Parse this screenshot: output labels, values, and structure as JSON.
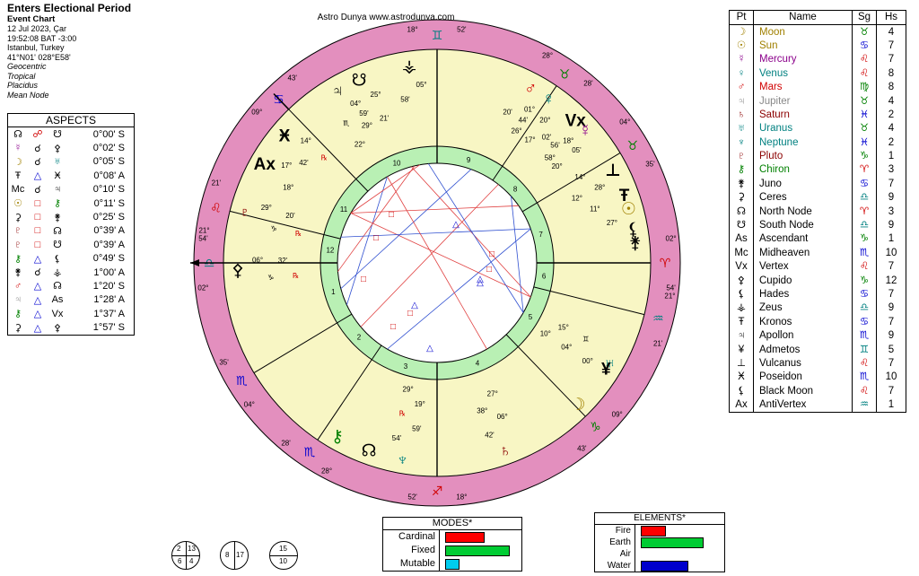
{
  "header": {
    "title": "Enters Electional Period",
    "subtitle": "Event Chart",
    "date": "12 Jul 2023, Çar",
    "time": "19:52:08  BAT -3:00",
    "place": "Istanbul, Turkey",
    "coords": "41°N01' 028°E58'",
    "lines": [
      "Geocentric",
      "Tropical",
      "Placidus",
      "Mean Node"
    ]
  },
  "credit": "Astro Dunya www.astrodunya.com",
  "aspects": {
    "title": "ASPECTS",
    "rows": [
      {
        "p1": "☊",
        "asp": "☍",
        "p2": "☋",
        "orb": "0°00' S",
        "c1": "#000",
        "c2": "#d00000",
        "c3": "#000"
      },
      {
        "p1": "☿",
        "asp": "☌",
        "p2": "⚴",
        "orb": "0°02' S",
        "c1": "#8b008b",
        "c2": "#000",
        "c3": "#000"
      },
      {
        "p1": "☽",
        "asp": "☌",
        "p2": "♅",
        "orb": "0°05' S",
        "c1": "#a08000",
        "c2": "#000",
        "c3": "#008080"
      },
      {
        "p1": "Ŧ",
        "asp": "△",
        "p2": "Ӿ",
        "orb": "0°08' A",
        "c1": "#000",
        "c2": "#0000d0",
        "c3": "#000"
      },
      {
        "p1": "Mc",
        "asp": "☌",
        "p2": "♃",
        "orb": "0°10' S",
        "c1": "#000",
        "c2": "#000",
        "c3": "#000"
      },
      {
        "p1": "☉",
        "asp": "□",
        "p2": "⚷",
        "orb": "0°11' S",
        "c1": "#a08000",
        "c2": "#d00000",
        "c3": "#008000"
      },
      {
        "p1": "⚳",
        "asp": "□",
        "p2": "⚵",
        "orb": "0°25' S",
        "c1": "#000",
        "c2": "#d00000",
        "c3": "#000"
      },
      {
        "p1": "♇",
        "asp": "□",
        "p2": "☊",
        "orb": "0°39' A",
        "c1": "#8b0000",
        "c2": "#d00000",
        "c3": "#000"
      },
      {
        "p1": "♇",
        "asp": "□",
        "p2": "☋",
        "orb": "0°39' A",
        "c1": "#8b0000",
        "c2": "#d00000",
        "c3": "#000"
      },
      {
        "p1": "⚷",
        "asp": "△",
        "p2": "⚸",
        "orb": "0°49' S",
        "c1": "#008000",
        "c2": "#0000d0",
        "c3": "#000"
      },
      {
        "p1": "⚵",
        "asp": "☌",
        "p2": "⚶",
        "orb": "1°00' A",
        "c1": "#000",
        "c2": "#000",
        "c3": "#000"
      },
      {
        "p1": "♂",
        "asp": "△",
        "p2": "☊",
        "orb": "1°20' S",
        "c1": "#d00000",
        "c2": "#0000d0",
        "c3": "#000"
      },
      {
        "p1": "♃",
        "asp": "△",
        "p2": "As",
        "orb": "1°28' A",
        "c1": "#888888",
        "c2": "#0000d0",
        "c3": "#000"
      },
      {
        "p1": "⚷",
        "asp": "△",
        "p2": "Vx",
        "orb": "1°37' A",
        "c1": "#008000",
        "c2": "#0000d0",
        "c3": "#000"
      },
      {
        "p1": "⚳",
        "asp": "△",
        "p2": "⚴",
        "orb": "1°57' S",
        "c1": "#000",
        "c2": "#0000d0",
        "c3": "#000"
      }
    ]
  },
  "planet_table": {
    "headers": [
      "Pt",
      "Name",
      "Sg",
      "Hs"
    ],
    "rows": [
      {
        "glyph": "☽",
        "name": "Moon",
        "sign": "♉",
        "house": "4",
        "color": "#a08000",
        "scolor": "#008000"
      },
      {
        "glyph": "☉",
        "name": "Sun",
        "sign": "♋",
        "house": "7",
        "color": "#a08000",
        "scolor": "#0000d0"
      },
      {
        "glyph": "☿",
        "name": "Mercury",
        "sign": "♌",
        "house": "7",
        "color": "#8b008b",
        "scolor": "#d00000"
      },
      {
        "glyph": "♀",
        "name": "Venus",
        "sign": "♌",
        "house": "8",
        "color": "#008080",
        "scolor": "#d00000"
      },
      {
        "glyph": "♂",
        "name": "Mars",
        "sign": "♍",
        "house": "8",
        "color": "#d00000",
        "scolor": "#008000"
      },
      {
        "glyph": "♃",
        "name": "Jupiter",
        "sign": "♉",
        "house": "4",
        "color": "#888888",
        "scolor": "#008000"
      },
      {
        "glyph": "♄",
        "name": "Saturn",
        "sign": "♓",
        "house": "2",
        "color": "#8b0000",
        "scolor": "#0000d0"
      },
      {
        "glyph": "♅",
        "name": "Uranus",
        "sign": "♉",
        "house": "4",
        "color": "#008080",
        "scolor": "#008000"
      },
      {
        "glyph": "♆",
        "name": "Neptune",
        "sign": "♓",
        "house": "2",
        "color": "#008080",
        "scolor": "#0000d0"
      },
      {
        "glyph": "♇",
        "name": "Pluto",
        "sign": "♑",
        "house": "1",
        "color": "#8b0000",
        "scolor": "#008000"
      },
      {
        "glyph": "⚷",
        "name": "Chiron",
        "sign": "♈",
        "house": "3",
        "color": "#008000",
        "scolor": "#d00000"
      },
      {
        "glyph": "⚵",
        "name": "Juno",
        "sign": "♋",
        "house": "7",
        "color": "#000",
        "scolor": "#0000d0"
      },
      {
        "glyph": "⚳",
        "name": "Ceres",
        "sign": "♎",
        "house": "9",
        "color": "#000",
        "scolor": "#008080"
      },
      {
        "glyph": "☊",
        "name": "North Node",
        "sign": "♈",
        "house": "3",
        "color": "#000",
        "scolor": "#d00000"
      },
      {
        "glyph": "☋",
        "name": "South Node",
        "sign": "♎",
        "house": "9",
        "color": "#000",
        "scolor": "#008080"
      },
      {
        "glyph": "As",
        "name": "Ascendant",
        "sign": "♑",
        "house": "1",
        "color": "#000",
        "scolor": "#008000"
      },
      {
        "glyph": "Mc",
        "name": "Midheaven",
        "sign": "♏",
        "house": "10",
        "color": "#000",
        "scolor": "#0000d0"
      },
      {
        "glyph": "Vx",
        "name": "Vertex",
        "sign": "♌",
        "house": "7",
        "color": "#000",
        "scolor": "#d00000"
      },
      {
        "glyph": "⚴",
        "name": "Cupido",
        "sign": "♑",
        "house": "12",
        "color": "#000",
        "scolor": "#008000"
      },
      {
        "glyph": "⚸",
        "name": "Hades",
        "sign": "♋",
        "house": "7",
        "color": "#000",
        "scolor": "#0000d0"
      },
      {
        "glyph": "⚶",
        "name": "Zeus",
        "sign": "♎",
        "house": "9",
        "color": "#000",
        "scolor": "#008080"
      },
      {
        "glyph": "Ŧ",
        "name": "Kronos",
        "sign": "♋",
        "house": "7",
        "color": "#000",
        "scolor": "#0000d0"
      },
      {
        "glyph": "♃",
        "name": "Apollon",
        "sign": "♏",
        "house": "9",
        "color": "#000",
        "scolor": "#0000d0"
      },
      {
        "glyph": "¥",
        "name": "Admetos",
        "sign": "♊",
        "house": "5",
        "color": "#000",
        "scolor": "#008080"
      },
      {
        "glyph": "⊥",
        "name": "Vulcanus",
        "sign": "♌",
        "house": "7",
        "color": "#000",
        "scolor": "#d00000"
      },
      {
        "glyph": "Ӿ",
        "name": "Poseidon",
        "sign": "♏",
        "house": "10",
        "color": "#000",
        "scolor": "#0000d0"
      },
      {
        "glyph": "⚸",
        "name": "Black Moon",
        "sign": "♌",
        "house": "7",
        "color": "#000",
        "scolor": "#d00000"
      },
      {
        "glyph": "Ax",
        "name": "AntiVertex",
        "sign": "♒",
        "house": "1",
        "color": "#000",
        "scolor": "#008080"
      }
    ]
  },
  "modes": {
    "title": "MODES*",
    "rows": [
      {
        "label": "Cardinal",
        "value": 6,
        "color": "#ff0000"
      },
      {
        "label": "Fixed",
        "value": 10,
        "color": "#00cc33"
      },
      {
        "label": "Mutable",
        "value": 2,
        "color": "#00ccee"
      }
    ]
  },
  "elements": {
    "title": "ELEMENTS*",
    "rows": [
      {
        "label": "Fire",
        "value": 3,
        "color": "#ff0000"
      },
      {
        "label": "Earth",
        "value": 8,
        "color": "#00cc33"
      },
      {
        "label": "Air",
        "value": 0,
        "color": "#ffffff"
      },
      {
        "label": "Water",
        "value": 6,
        "color": "#0000cc"
      }
    ]
  },
  "hemispheres": {
    "quad": [
      "2",
      "13",
      "6",
      "4"
    ],
    "halves": [
      "8",
      "17"
    ],
    "updown": [
      "15",
      "10"
    ]
  },
  "wheel": {
    "colors": {
      "outer": "#e38fbe",
      "inner": "#f8f6c4",
      "house_ring": "#b9f0b4",
      "line_red": "#e04040",
      "line_blue": "#3050d0"
    },
    "house_numbers": [
      "1",
      "2",
      "3",
      "4",
      "5",
      "6",
      "7",
      "8",
      "9",
      "10",
      "11",
      "12"
    ],
    "cusp_labels": [
      {
        "deg": "02°",
        "sign": "♎",
        "min": "54'",
        "sc": "#008080"
      },
      {
        "deg": "04°",
        "sign": "♏",
        "min": "35'",
        "sc": "#0000d0"
      },
      {
        "deg": "28°",
        "sign": "♏",
        "min": "28'",
        "sc": "#0000d0"
      },
      {
        "deg": "18°",
        "sign": "♐",
        "min": "52'",
        "sc": "#d00000"
      },
      {
        "deg": "09°",
        "sign": "♑",
        "min": "43'",
        "sc": "#008000"
      },
      {
        "deg": "21°",
        "sign": "♒",
        "min": "21'",
        "sc": "#008080"
      },
      {
        "deg": "02°",
        "sign": "♈",
        "min": "54'",
        "sc": "#d00000"
      },
      {
        "deg": "04°",
        "sign": "♉",
        "min": "35'",
        "sc": "#008000"
      },
      {
        "deg": "28°",
        "sign": "♉",
        "min": "28'",
        "sc": "#008000"
      },
      {
        "deg": "18°",
        "sign": "♊",
        "min": "52'",
        "sc": "#008080"
      },
      {
        "deg": "09°",
        "sign": "♋",
        "min": "43'",
        "sc": "#0000d0"
      },
      {
        "deg": "21°",
        "sign": "♌",
        "min": "21'",
        "sc": "#d00000"
      }
    ],
    "placements": [
      {
        "g": "♃",
        "t": "04° ♏ 29° 22°",
        "c": "#000"
      },
      {
        "g": "☋",
        "t": "25° 59' 21'",
        "c": "#000"
      },
      {
        "g": "⚶",
        "t": "05° 58'",
        "c": "#000"
      },
      {
        "g": "Ӿ",
        "t": "14° 42' ℞",
        "c": "#000"
      },
      {
        "g": "♂",
        "t": "01° 20' 26°",
        "c": "#d00000"
      },
      {
        "g": "♀",
        "t": "20° 44' 17°",
        "c": "#008080"
      },
      {
        "g": "Vx",
        "t": "18° 02' 58°",
        "c": "#000"
      },
      {
        "g": "☿",
        "t": "05' 56' 20°",
        "c": "#8b008b"
      },
      {
        "g": "⊥",
        "t": "28° 14° 12°",
        "c": "#000"
      },
      {
        "g": "☉",
        "t": "27° 11°",
        "c": "#a08000"
      },
      {
        "g": "Ŧ",
        "t": "",
        "c": "#000"
      },
      {
        "g": "⚸",
        "t": "",
        "c": "#000"
      },
      {
        "g": "⚵",
        "t": "",
        "c": "#000"
      },
      {
        "g": "⚴",
        "t": "06° ♑ 32' ℞",
        "c": "#000"
      },
      {
        "g": "♇",
        "t": "29° ♑ 20' ℞",
        "c": "#8b0000"
      },
      {
        "g": "Ax",
        "t": "17° 18°",
        "c": "#000"
      },
      {
        "g": "♅",
        "t": "00° ♊ 04° 15° 10° 05° 11° 22° 11°",
        "c": "#008080"
      },
      {
        "g": "¥",
        "t": "",
        "c": "#000"
      },
      {
        "g": "☽",
        "t": "",
        "c": "#a08000"
      },
      {
        "g": "♄",
        "t": "42' 06° 38° 27°",
        "c": "#8b0000"
      },
      {
        "g": "♆",
        "t": "54' 59' ℞ 19° 29°",
        "c": "#008080"
      },
      {
        "g": "☊",
        "t": "",
        "c": "#000"
      },
      {
        "g": "⚷",
        "t": "",
        "c": "#008000"
      }
    ]
  }
}
